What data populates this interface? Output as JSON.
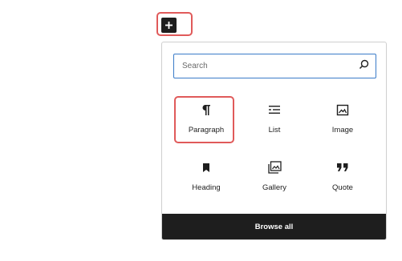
{
  "search": {
    "placeholder": "Search"
  },
  "blocks": [
    {
      "label": "Paragraph",
      "icon": "paragraph-icon"
    },
    {
      "label": "List",
      "icon": "list-icon"
    },
    {
      "label": "Image",
      "icon": "image-icon"
    },
    {
      "label": "Heading",
      "icon": "bookmark-icon"
    },
    {
      "label": "Gallery",
      "icon": "gallery-icon"
    },
    {
      "label": "Quote",
      "icon": "quote-icon"
    }
  ],
  "footer": {
    "browse_label": "Browse all"
  },
  "colors": {
    "highlight": "#e05a5a",
    "accent": "#3a7bc8",
    "dark": "#1e1e1e"
  }
}
